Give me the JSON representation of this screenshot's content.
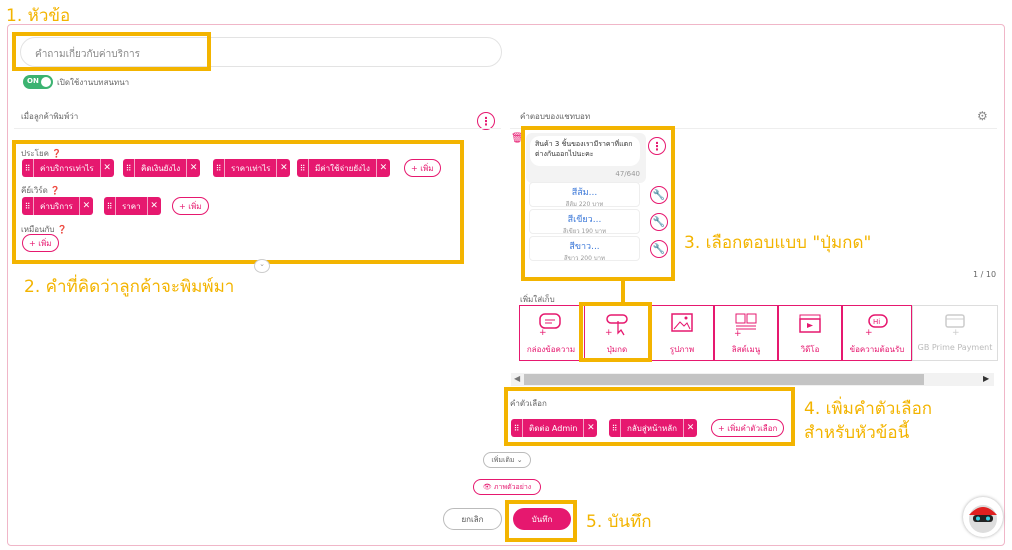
{
  "annotations": {
    "a1": "1. หัวข้อ",
    "a2": "2. คำที่คิดว่าลูกค้าจะพิมพ์มา",
    "a3": "3. เลือกตอบแบบ \"ปุ่มกด\"",
    "a4_line1": "4. เพิ่มคำตัวเลือก",
    "a4_line2": "สำหรับหัวข้อนี้",
    "a5": "5. บันทึก"
  },
  "topic": {
    "placeholder": "คำถามเกี่ยวกับค่าบริการ"
  },
  "toggle": {
    "on": "ON",
    "label": "เปิดใช้งานบทสนทนา"
  },
  "left": {
    "header": "เมื่อลูกค้าพิมพ์ว่า",
    "sentence_label": "ประโยค",
    "sentences": [
      "ค่าบริการเท่าไร",
      "คิดเงินยังไง",
      "ราคาเท่าไร",
      "มีค่าใช้จ่ายยังไง"
    ],
    "keyword_label": "คีย์เวิร์ด",
    "keywords": [
      "ค่าบริการ",
      "ราคา"
    ],
    "exact_label": "เหมือนกับ",
    "add": "เพิ่ม"
  },
  "right": {
    "header": "คำตอบของแชทบอท",
    "message": "สินค้า 3 ชิ้นของเรามีราคาที่แตกต่างกันออกไปนะคะ",
    "counter": "47/640",
    "options": [
      {
        "title": "สีส้ม...",
        "sub": "สีส้ม 220 บาท"
      },
      {
        "title": "สีเขียว...",
        "sub": "สีเขียว 190 บาท"
      },
      {
        "title": "สีขาว...",
        "sub": "สีขาว 200 บาท"
      }
    ],
    "page": "1 / 10",
    "add_more": "เพิ่มใส่เก็บ",
    "tiles": [
      "กล่องข้อความ",
      "ปุ่มกด",
      "รูปภาพ",
      "ลิสต์เมนู",
      "วิดีโอ",
      "ข้อความต้อนรับ",
      "GB Prime Payment"
    ],
    "choice_label": "คำตัวเลือก",
    "choices": [
      "ติดต่อ Admin",
      "กลับสู่หน้าหลัก"
    ],
    "add_choice": "เพิ่มคำตัวเลือก"
  },
  "more": "เพิ่มเติม",
  "preview": "ภาพตัวอย่าง",
  "cancel": "ยกเลิก",
  "save": "บันทึก",
  "colors": {
    "accent": "#e6186f",
    "annotation": "#f3b400",
    "toggle": "#3cb371"
  }
}
